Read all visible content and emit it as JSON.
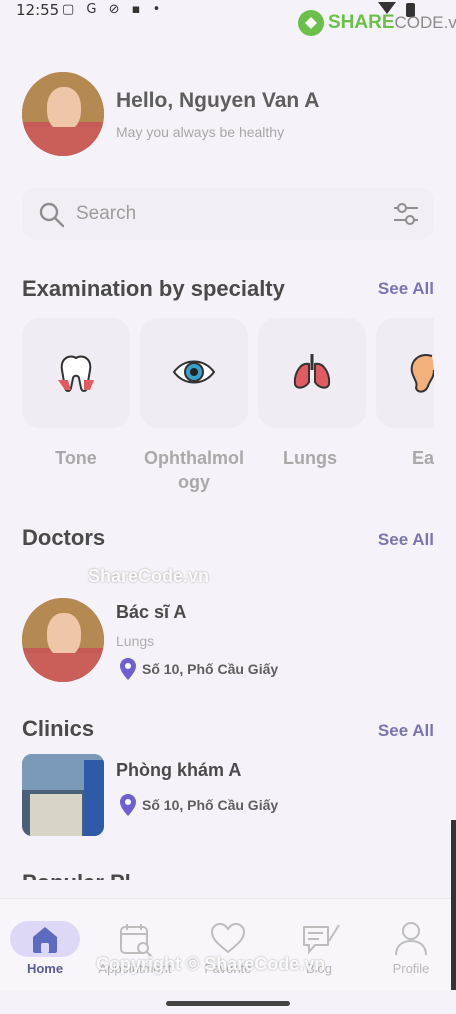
{
  "status": {
    "time": "12:55",
    "icons": "▢ G ⊘ ▪ •"
  },
  "branding": {
    "logo_main": "SHARE",
    "logo_suffix": "CODE.vn",
    "watermark_mid": "ShareCode.vn",
    "watermark_bottom": "Copyright © ShareCode.vn"
  },
  "header": {
    "greeting": "Hello, Nguyen Van A",
    "subtitle": "May you always be healthy"
  },
  "search": {
    "placeholder": "Search"
  },
  "specialty": {
    "title": "Examination by specialty",
    "see_all": "See All",
    "items": [
      {
        "label": "Tone",
        "icon": "tooth-icon"
      },
      {
        "label": "Ophthalmol\nogy",
        "icon": "eye-icon"
      },
      {
        "label": "Lungs",
        "icon": "lungs-icon"
      },
      {
        "label": "Ea",
        "icon": "ear-icon"
      }
    ]
  },
  "doctors": {
    "title": "Doctors",
    "see_all": "See All",
    "items": [
      {
        "name": "Bác sĩ A",
        "specialty": "Lungs",
        "address": "Số 10, Phố Cầu Giấy"
      }
    ]
  },
  "clinics": {
    "title": "Clinics",
    "see_all": "See All",
    "items": [
      {
        "name": "Phòng khám A",
        "address": "Số 10, Phố Cầu Giấy"
      }
    ]
  },
  "peek": {
    "title": "Popular Pl"
  },
  "nav": {
    "items": [
      {
        "label": "Home",
        "icon": "home-icon",
        "active": true
      },
      {
        "label": "Appointment",
        "icon": "calendar-icon",
        "active": false
      },
      {
        "label": "Favorite",
        "icon": "heart-icon",
        "active": false
      },
      {
        "label": "Blog",
        "icon": "blog-icon",
        "active": false
      },
      {
        "label": "Profile",
        "icon": "user-icon",
        "active": false
      }
    ]
  },
  "colors": {
    "accent": "#7a74b5",
    "active_pill": "#dcd8f6",
    "pin": "#6f5fd0",
    "logo": "#6cc04a"
  }
}
